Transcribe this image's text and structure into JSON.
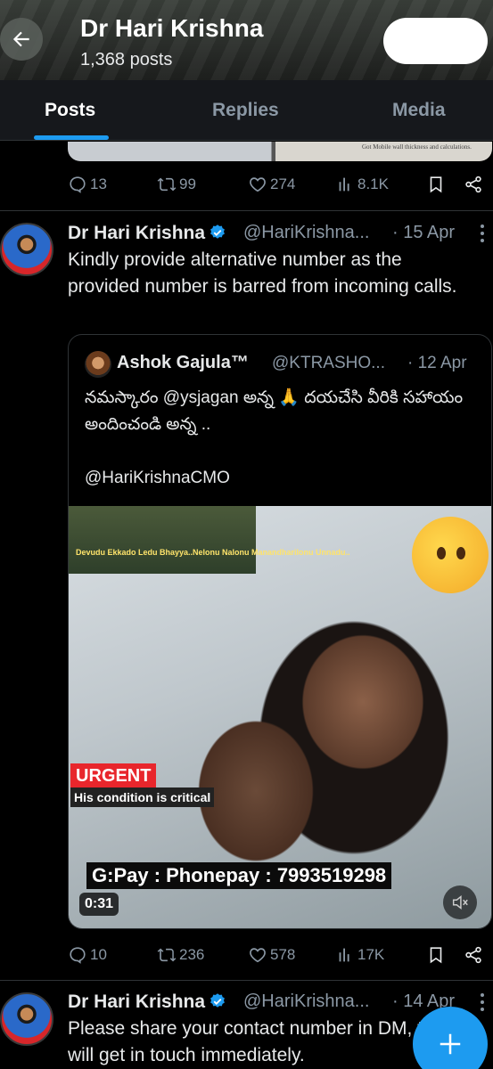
{
  "header": {
    "title": "Dr Hari Krishna",
    "posts_count": "1,368 posts"
  },
  "tabs": [
    {
      "label": "Posts",
      "active": true
    },
    {
      "label": "Replies",
      "active": false
    },
    {
      "label": "Media",
      "active": false
    }
  ],
  "prev_tweet": {
    "media_text": "Got Mobile wall thickness and calculations.",
    "replies": "13",
    "reposts": "99",
    "likes": "274",
    "views": "8.1K"
  },
  "tweet1": {
    "name": "Dr Hari Krishna",
    "handle": "@HariKrishna...",
    "date": "· 15 Apr",
    "text": "Kindly provide alternative number as the provided number is barred from incoming calls.",
    "quote": {
      "name": "Ashok Gajula™",
      "handle": "@KTRASHO...",
      "date": "· 12 Apr",
      "text": "నమస్కారం @ysjagan అన్న 🙏  దయచేసి వీరికి సహాయం అందించండి అన్న ..\n\n@HariKrishnaCMO",
      "media": {
        "caption": "Devudu Ekkado Ledu Bhayya..Nelonu Nalonu Manandharilonu Unnadu..",
        "urgent": "URGENT",
        "condition": "His condition is critical",
        "payment": "G:Pay : Phonepay : 7993519298",
        "duration": "0:31"
      }
    },
    "replies": "10",
    "reposts": "236",
    "likes": "578",
    "views": "17K"
  },
  "tweet2": {
    "name": "Dr Hari Krishna",
    "handle": "@HariKrishna...",
    "date": "· 14 Apr",
    "text": "Please share your contact number in DM, team will get in touch immediately."
  },
  "colors": {
    "accent": "#1d9bf0",
    "background": "#000000",
    "secondary_text": "#8b98a5"
  }
}
